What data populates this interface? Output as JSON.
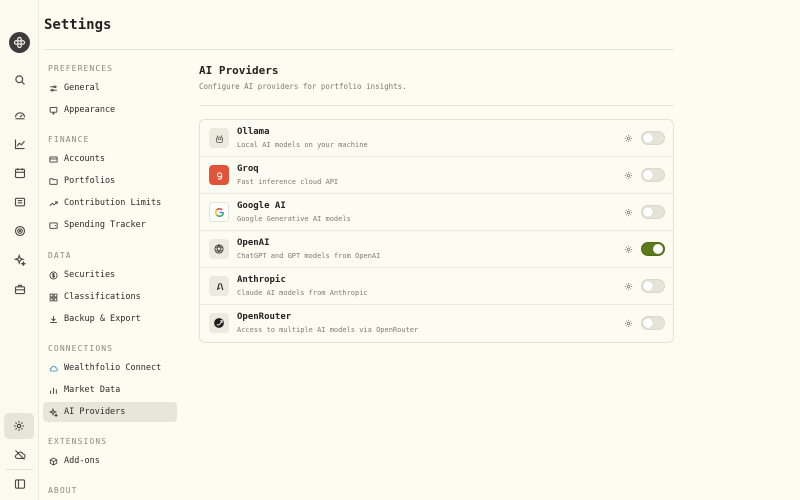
{
  "page": {
    "title": "Settings"
  },
  "nav": {
    "sections": [
      {
        "label": "PREFERENCES",
        "items": [
          {
            "label": "General",
            "icon": "sliders-icon"
          },
          {
            "label": "Appearance",
            "icon": "monitor-icon"
          }
        ]
      },
      {
        "label": "FINANCE",
        "items": [
          {
            "label": "Accounts",
            "icon": "card-icon"
          },
          {
            "label": "Portfolios",
            "icon": "folder-icon"
          },
          {
            "label": "Contribution Limits",
            "icon": "trend-up-icon"
          },
          {
            "label": "Spending Tracker",
            "icon": "wallet-icon"
          }
        ]
      },
      {
        "label": "DATA",
        "items": [
          {
            "label": "Securities",
            "icon": "dollar-icon"
          },
          {
            "label": "Classifications",
            "icon": "blocks-icon"
          },
          {
            "label": "Backup & Export",
            "icon": "download-icon"
          }
        ]
      },
      {
        "label": "CONNECTIONS",
        "items": [
          {
            "label": "Wealthfolio Connect",
            "icon": "cloud-icon"
          },
          {
            "label": "Market Data",
            "icon": "bar-chart-icon"
          },
          {
            "label": "AI Providers",
            "icon": "sparkles-icon",
            "active": true
          }
        ]
      },
      {
        "label": "EXTENSIONS",
        "items": [
          {
            "label": "Add-ons",
            "icon": "package-icon"
          }
        ]
      },
      {
        "label": "ABOUT",
        "items": []
      }
    ]
  },
  "main": {
    "title": "AI Providers",
    "subtitle": "Configure AI providers for portfolio insights.",
    "providers": [
      {
        "name": "Ollama",
        "description": "Local AI models on your machine",
        "enabled": false,
        "logo": "ollama-icon"
      },
      {
        "name": "Groq",
        "description": "Fast inference cloud API",
        "enabled": false,
        "logo": "groq-icon"
      },
      {
        "name": "Google AI",
        "description": "Google Generative AI models",
        "enabled": false,
        "logo": "google-icon"
      },
      {
        "name": "OpenAI",
        "description": "ChatGPT and GPT models from OpenAI",
        "enabled": true,
        "logo": "openai-icon"
      },
      {
        "name": "Anthropic",
        "description": "Claude AI models from Anthropic",
        "enabled": false,
        "logo": "anthropic-icon"
      },
      {
        "name": "OpenRouter",
        "description": "Access to multiple AI models via OpenRouter",
        "enabled": false,
        "logo": "openrouter-icon"
      }
    ]
  },
  "colors": {
    "background": "#fdfcf0",
    "toggle_on": "#5b7a1a",
    "groq_red": "#e2543a"
  }
}
